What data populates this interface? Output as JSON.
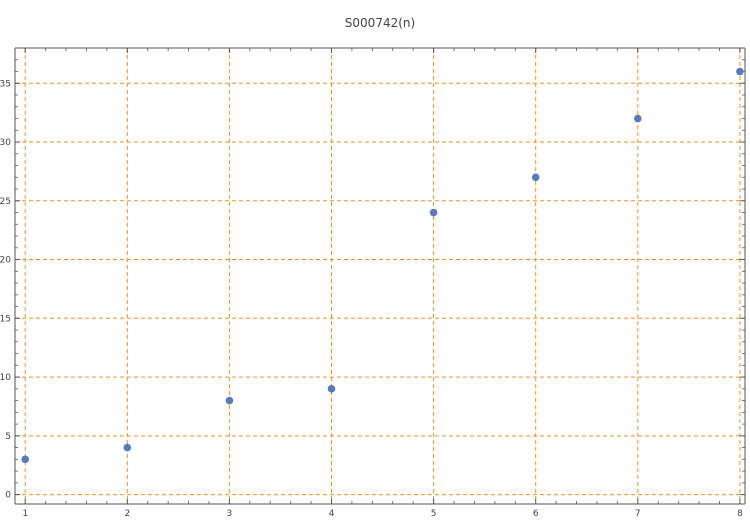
{
  "chart_data": {
    "type": "scatter",
    "title": "S000742(n)",
    "xlabel": "",
    "ylabel": "",
    "xlim": [
      0.9,
      8.05
    ],
    "ylim": [
      -0.8,
      38
    ],
    "x_ticks": [
      1,
      2,
      3,
      4,
      5,
      6,
      7,
      8
    ],
    "y_ticks": [
      0,
      5,
      10,
      15,
      20,
      25,
      30,
      35
    ],
    "grid": true,
    "grid_style": "dashed",
    "grid_color": "#e8932a",
    "marker_color": "#5a7ab8",
    "axis_color": "#555555",
    "series": [
      {
        "x": [
          1,
          2,
          3,
          4,
          5,
          6,
          7,
          8
        ],
        "values": [
          3,
          4,
          8,
          9,
          24,
          27,
          32,
          36
        ]
      }
    ]
  }
}
